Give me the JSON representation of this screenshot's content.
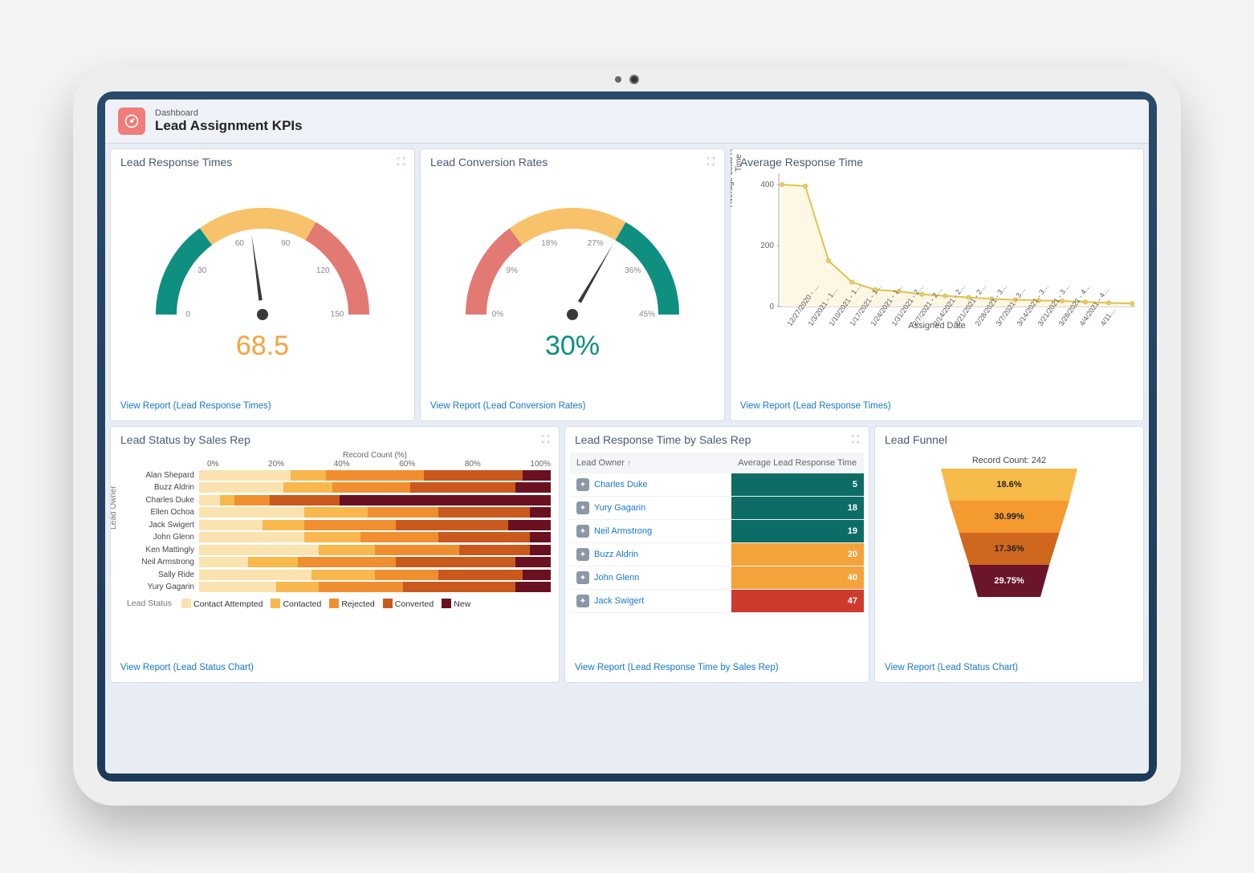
{
  "header": {
    "crumb": "Dashboard",
    "title": "Lead Assignment KPIs",
    "icon_name": "gauge-icon"
  },
  "cards": {
    "response_times": {
      "title": "Lead Response Times",
      "value_display": "68.5",
      "footer_link": "View Report (Lead Response Times)"
    },
    "conversion_rates": {
      "title": "Lead Conversion Rates",
      "value_display": "30%",
      "footer_link": "View Report (Lead Conversion Rates)"
    },
    "avg_response": {
      "title": "Average Response Time",
      "y_axis_label": "Average Lead Response Time",
      "x_axis_label": "Assigned Date",
      "footer_link": "View Report (Lead Response Times)"
    },
    "status_by_rep": {
      "title": "Lead Status by Sales Rep",
      "x_axis_label": "Record Count (%)",
      "y_axis_label": "Lead Owner",
      "legend_title": "Lead Status",
      "legend": [
        "Contact Attempted",
        "Contacted",
        "Rejected",
        "Converted",
        "New"
      ],
      "footer_link": "View Report (Lead Status Chart)"
    },
    "resp_by_rep": {
      "title": "Lead Response Time by Sales Rep",
      "col1": "Lead Owner",
      "col2": "Average Lead Response Time",
      "footer_link": "View Report (Lead Response Time by Sales Rep)"
    },
    "funnel": {
      "title": "Lead Funnel",
      "subtitle": "Record Count: 242",
      "footer_link": "View Report (Lead Status Chart)"
    }
  },
  "chart_data": [
    {
      "id": "lead_response_times_gauge",
      "type": "gauge",
      "value": 68.5,
      "min": 0,
      "max": 150,
      "tick_labels": [
        0,
        30,
        60,
        90,
        120,
        150
      ],
      "bands": [
        {
          "from": 0,
          "to": 45,
          "color": "#0f8f80"
        },
        {
          "from": 45,
          "to": 100,
          "color": "#f8c26a"
        },
        {
          "from": 100,
          "to": 150,
          "color": "#e27a73"
        }
      ]
    },
    {
      "id": "lead_conversion_rates_gauge",
      "type": "gauge",
      "value": 30,
      "unit": "%",
      "min": 0,
      "max": 45,
      "tick_labels": [
        "0%",
        "9%",
        "18%",
        "27%",
        "36%",
        "45%"
      ],
      "bands": [
        {
          "from": 0,
          "to": 13.5,
          "color": "#e27a73"
        },
        {
          "from": 13.5,
          "to": 30,
          "color": "#f8c26a"
        },
        {
          "from": 30,
          "to": 45,
          "color": "#0f8f80"
        }
      ]
    },
    {
      "id": "average_response_time_line",
      "type": "line",
      "xlabel": "Assigned Date",
      "ylabel": "Average Lead Response Time",
      "ylim": [
        0,
        400
      ],
      "y_ticks": [
        0,
        200,
        400
      ],
      "categories": [
        "12/27/2020 - …",
        "1/3/2021 - 1…",
        "1/10/2021 - 1…",
        "1/17/2021 - 1…",
        "1/24/2021 - 1…",
        "1/31/2021 - 2…",
        "2/7/2021 - 2…",
        "2/14/2021 - 2…",
        "2/21/2021 - 2…",
        "2/28/2021 - 3…",
        "3/7/2021 - 3…",
        "3/14/2021 - 3…",
        "3/21/2021 - 3…",
        "3/28/2021 - 4…",
        "4/4/2021 - 4…",
        "4/11…"
      ],
      "values": [
        400,
        395,
        150,
        80,
        55,
        50,
        40,
        35,
        30,
        25,
        22,
        20,
        18,
        15,
        12,
        10
      ]
    },
    {
      "id": "lead_status_by_rep_stacked",
      "type": "stacked_bar_100",
      "xlabel": "Record Count (%)",
      "x_ticks": [
        "0%",
        "20%",
        "40%",
        "60%",
        "80%",
        "100%"
      ],
      "series_names": [
        "Contact Attempted",
        "Contacted",
        "Rejected",
        "Converted",
        "New"
      ],
      "rows": [
        {
          "name": "Alan Shepard",
          "values": [
            26,
            10,
            28,
            28,
            8
          ]
        },
        {
          "name": "Buzz Aldrin",
          "values": [
            24,
            14,
            22,
            30,
            10
          ]
        },
        {
          "name": "Charles Duke",
          "values": [
            6,
            4,
            10,
            20,
            60
          ]
        },
        {
          "name": "Ellen Ochoa",
          "values": [
            30,
            18,
            20,
            26,
            6
          ]
        },
        {
          "name": "Jack Swigert",
          "values": [
            18,
            12,
            26,
            32,
            12
          ]
        },
        {
          "name": "John Glenn",
          "values": [
            30,
            16,
            22,
            26,
            6
          ]
        },
        {
          "name": "Ken Mattingly",
          "values": [
            34,
            16,
            24,
            20,
            6
          ]
        },
        {
          "name": "Neil Armstrong",
          "values": [
            14,
            14,
            28,
            34,
            10
          ]
        },
        {
          "name": "Sally Ride",
          "values": [
            32,
            18,
            18,
            24,
            8
          ]
        },
        {
          "name": "Yury Gagarin",
          "values": [
            22,
            12,
            24,
            32,
            10
          ]
        }
      ]
    },
    {
      "id": "response_time_by_rep_table",
      "type": "table",
      "columns": [
        "Lead Owner",
        "Average Lead Response Time"
      ],
      "rows": [
        {
          "name": "Charles Duke",
          "value": 5,
          "color": "#0d6d66"
        },
        {
          "name": "Yury Gagarin",
          "value": 18,
          "color": "#0d6d66"
        },
        {
          "name": "Neil Armstrong",
          "value": 19,
          "color": "#0d6d66"
        },
        {
          "name": "Buzz Aldrin",
          "value": 20,
          "color": "#f4a33a"
        },
        {
          "name": "John Glenn",
          "value": 40,
          "color": "#f4a33a"
        },
        {
          "name": "Jack Swigert",
          "value": 47,
          "color": "#cf3a2e"
        }
      ]
    },
    {
      "id": "lead_funnel",
      "type": "funnel",
      "total_label": "Record Count: 242",
      "segments": [
        {
          "label": "18.6%",
          "value": 18.6,
          "color": "#f7bb49"
        },
        {
          "label": "30.99%",
          "value": 30.99,
          "color": "#f49a2f"
        },
        {
          "label": "17.36%",
          "value": 17.36,
          "color": "#cf671f"
        },
        {
          "label": "29.75%",
          "value": 29.75,
          "color": "#6a152a",
          "text_color": "#fff"
        }
      ]
    }
  ]
}
